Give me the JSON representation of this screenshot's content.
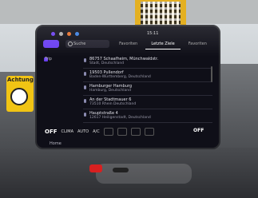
{
  "scene": {
    "sign_text": "Achtung"
  },
  "screen": {
    "status": {
      "time": "15:11"
    },
    "search": {
      "placeholder": "Suche"
    },
    "tabs": [
      {
        "label": "Favoriten"
      },
      {
        "label": "Letzte Ziele"
      },
      {
        "label": "Favoriten"
      }
    ],
    "side": {
      "trip_label": "Trip",
      "home_label": "Home"
    },
    "destinations": [
      {
        "title": "86757 Schaafheim, Münchwaldstr.",
        "sub": "Stadt, Deutschland"
      },
      {
        "title": "19503 Pullendorf",
        "sub": "Baden-Württemberg, Deutschland"
      },
      {
        "title": "Hamburger Hamburg",
        "sub": "Hamburg, Deutschland"
      },
      {
        "title": "An der Stadtmauer 6",
        "sub": "73510 Rhein Deutschland"
      },
      {
        "title": "Hauptstraße 4",
        "sub": "12617 Heiligenstadt, Deutschland"
      }
    ],
    "climate": {
      "off_left": "OFF",
      "mode_label": "CLIMA",
      "auto_label": "AUTO",
      "temp_label": "A/C",
      "off_right": "OFF"
    }
  },
  "colors": {
    "accent": "#6a3ff0",
    "screen_bg": "#0f0f18",
    "sign": "#f1c414",
    "qr_background": "#e4b021"
  }
}
